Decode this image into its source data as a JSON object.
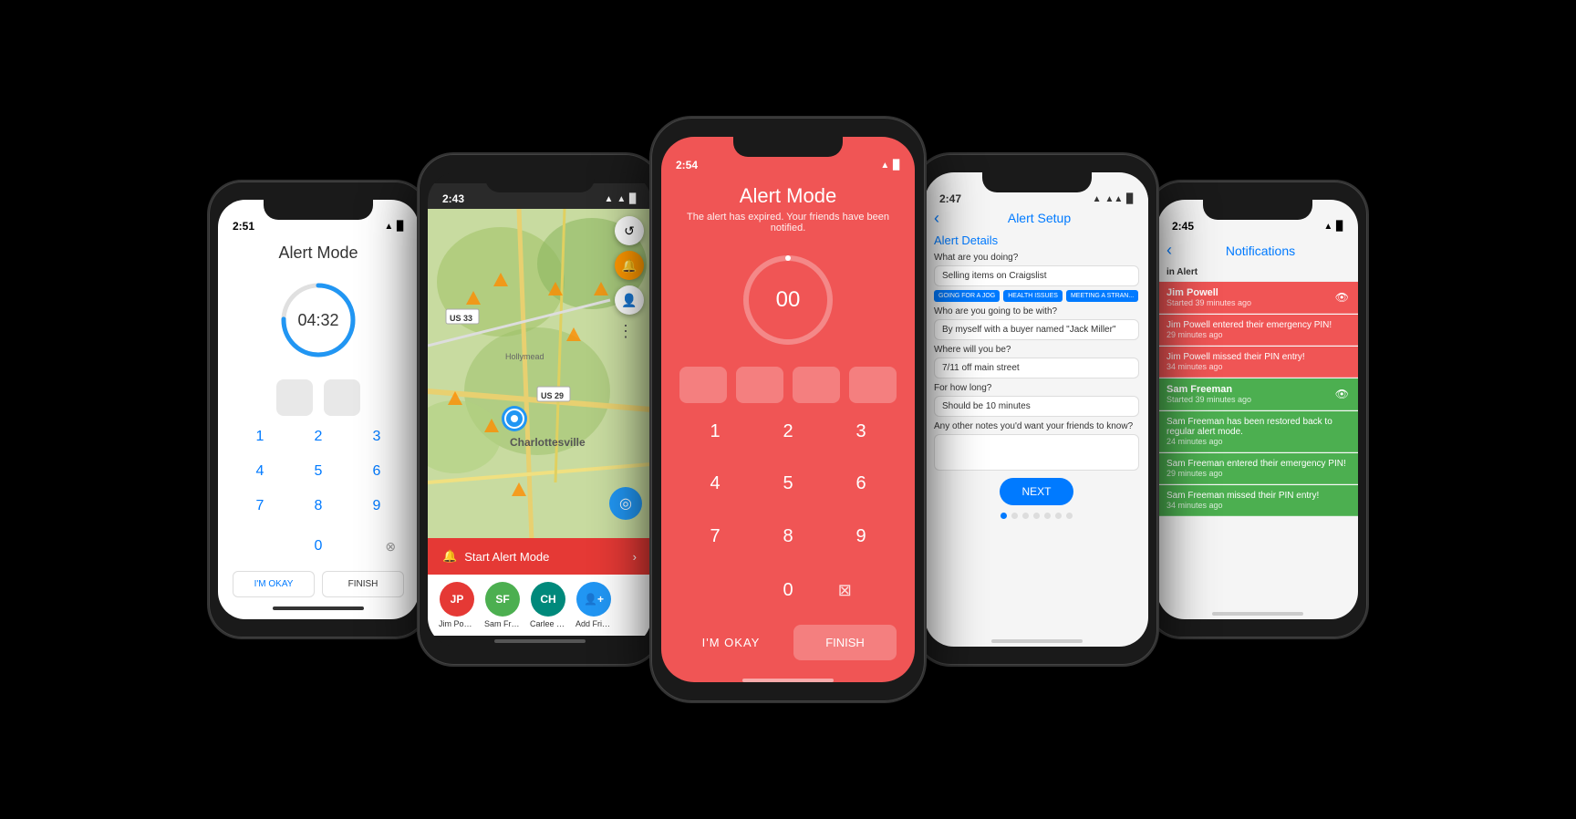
{
  "phone1": {
    "time": "2:51",
    "title": "Alert Mode",
    "timer": "04:32",
    "keys": [
      "1",
      "2",
      "3",
      "4",
      "5",
      "6",
      "7",
      "8",
      "9"
    ],
    "zero": "0",
    "btn_okay": "I'M OKAY",
    "btn_finish": "FINISH"
  },
  "phone2": {
    "time": "2:43",
    "start_alert": "Start Alert Mode",
    "friends": [
      {
        "initials": "JP",
        "name": "Jim Powell",
        "color": "#e53935"
      },
      {
        "initials": "SF",
        "name": "Sam Freem...",
        "color": "#4caf50"
      },
      {
        "initials": "CH",
        "name": "Carlee Han...",
        "color": "#00897b"
      },
      {
        "initials": "add",
        "name": "Add Friend",
        "color": "#2196F3"
      }
    ]
  },
  "phone3": {
    "time": "2:54",
    "title": "Alert Mode",
    "subtitle": "The alert has expired. Your friends have been notified.",
    "timer": "00",
    "keys": [
      "1",
      "2",
      "3",
      "4",
      "5",
      "6",
      "7",
      "8",
      "9"
    ],
    "zero": "0",
    "btn_okay": "I'M OKAY",
    "btn_finish": "FINISH"
  },
  "phone4": {
    "time": "2:47",
    "screen_title": "Alert Setup",
    "section_label": "Alert Details",
    "fields": [
      {
        "label": "What are you doing?",
        "value": "Selling items on Craigslist"
      },
      {
        "label": "Who are you going to be with?",
        "value": "By myself with a buyer named \"Jack Miller\""
      },
      {
        "label": "Where will you be?",
        "value": "7/11 off main street"
      },
      {
        "label": "For how long?",
        "value": "Should be 10 minutes"
      },
      {
        "label": "Any other notes you'd want your friends to know?",
        "value": ""
      }
    ],
    "tags": [
      "GOING FOR A JOG",
      "HEALTH ISSUES",
      "MEETING A STRAN..."
    ],
    "next_btn": "NEXT",
    "dots": [
      true,
      false,
      false,
      false,
      false,
      false,
      false
    ]
  },
  "phone5": {
    "time": "2:45",
    "title": "Notifications",
    "section": "in Alert",
    "notifications": [
      {
        "name": "Jim Powell",
        "time": "Started 39 minutes ago",
        "message": "",
        "type": "red",
        "eye": true
      },
      {
        "name": "Jim Powell entered their emergency PIN!",
        "time": "29 minutes ago",
        "message": "",
        "type": "red",
        "eye": false
      },
      {
        "name": "Jim Powell missed their PIN entry!",
        "time": "34 minutes ago",
        "message": "",
        "type": "red",
        "eye": false
      },
      {
        "name": "Sam Freeman",
        "time": "Started 39 minutes ago",
        "message": "",
        "type": "green",
        "eye": true
      },
      {
        "name": "Sam Freeman has been restored back to regular alert mode.",
        "time": "24 minutes ago",
        "message": "",
        "type": "green",
        "eye": false
      },
      {
        "name": "Sam Freeman entered their emergency PIN!",
        "time": "29 minutes ago",
        "message": "",
        "type": "green",
        "eye": false
      },
      {
        "name": "Sam Freeman missed their PIN entry!",
        "time": "34 minutes ago",
        "message": "",
        "type": "green",
        "eye": false
      }
    ]
  }
}
